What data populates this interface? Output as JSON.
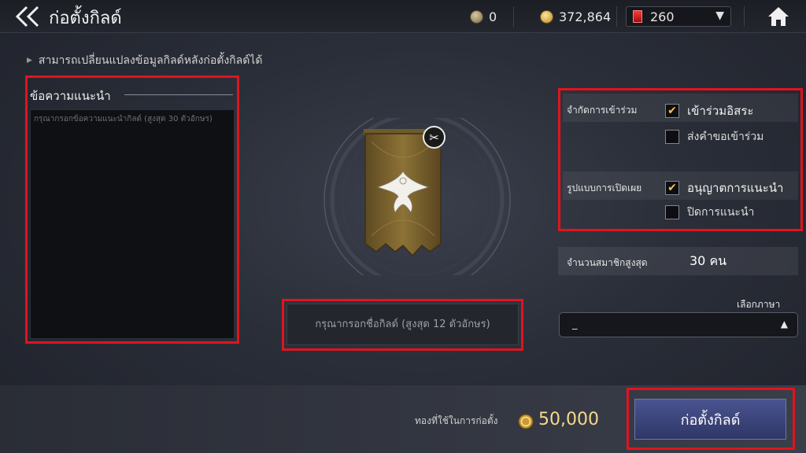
{
  "header": {
    "title": "ก่อตั้งกิลด์",
    "silver_amount": "0",
    "gold_amount": "372,864",
    "gem_amount": "260"
  },
  "notice": "สามารถเปลี่ยนแปลงข้อมูลกิลด์หลังก่อตั้งกิลด์ได้",
  "intro": {
    "title": "ข้อความแนะนำ",
    "placeholder": "กรุณากรอกข้อความแนะนำกิลด์ (สูงสุด 30 ตัวอักษร)"
  },
  "guild_name": {
    "placeholder": "กรุณากรอกชื่อกิลด์ (สูงสุด 12 ตัวอักษร)"
  },
  "settings": {
    "join_label": "จำกัดการเข้าร่วม",
    "join_options": [
      {
        "label": "เข้าร่วมอิสระ",
        "checked": true
      },
      {
        "label": "ส่งคำขอเข้าร่วม",
        "checked": false
      }
    ],
    "visibility_label": "รูปแบบการเปิดเผย",
    "visibility_options": [
      {
        "label": "อนุญาตการแนะนำ",
        "checked": true
      },
      {
        "label": "ปิดการแนะนำ",
        "checked": false
      }
    ],
    "max_members_label": "จำนวนสมาชิกสูงสุด",
    "max_members_value": "30 คน",
    "language_label": "เลือกภาษา",
    "language_value": "_"
  },
  "footer": {
    "cost_label": "ทองที่ใช้ในการก่อตั้ง",
    "cost_value": "50,000",
    "create_button": "ก่อตั้งกิลด์"
  },
  "icons": [
    "back-arrow-icon",
    "silver-coin-icon",
    "gold-coin-icon",
    "red-gem-icon",
    "home-icon",
    "scissors-icon",
    "guild-banner-emblem"
  ],
  "colors": {
    "highlight_frame": "#e0141e",
    "checkmark": "#f2c54a",
    "create_button": "#3b4478",
    "cost_gold": "#f7d98a"
  }
}
